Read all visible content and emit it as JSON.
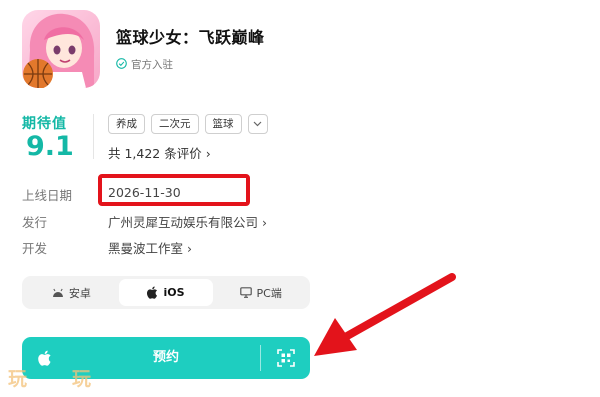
{
  "app": {
    "title": "篮球少女：飞跃巅峰",
    "verified_label": "官方入驻"
  },
  "rating": {
    "label": "期待值",
    "value": "9.1",
    "reviews_text": "共 1,422 条评价 ›"
  },
  "tags": [
    "养成",
    "二次元",
    "篮球"
  ],
  "info": {
    "release_label": "上线日期",
    "release_value": "2026-11-30",
    "publisher_label": "发行",
    "publisher_value": "广州灵犀互动娱乐有限公司 ›",
    "developer_label": "开发",
    "developer_value": "黑曼波工作室 ›"
  },
  "platform_tabs": [
    {
      "label": "安卓",
      "icon": "android-icon",
      "active": false
    },
    {
      "label": "iOS",
      "icon": "apple-icon",
      "active": true
    },
    {
      "label": "PC端",
      "icon": "monitor-icon",
      "active": false
    }
  ],
  "reserve_button": {
    "label": "预约",
    "icon": "apple-icon",
    "qr_icon": "qr-code-icon"
  },
  "watermark": {
    "text_left": "玩",
    "text_right": "玩"
  },
  "colors": {
    "accent": "#14b8a6",
    "button": "#1ecec0",
    "highlight": "#e3131b"
  }
}
